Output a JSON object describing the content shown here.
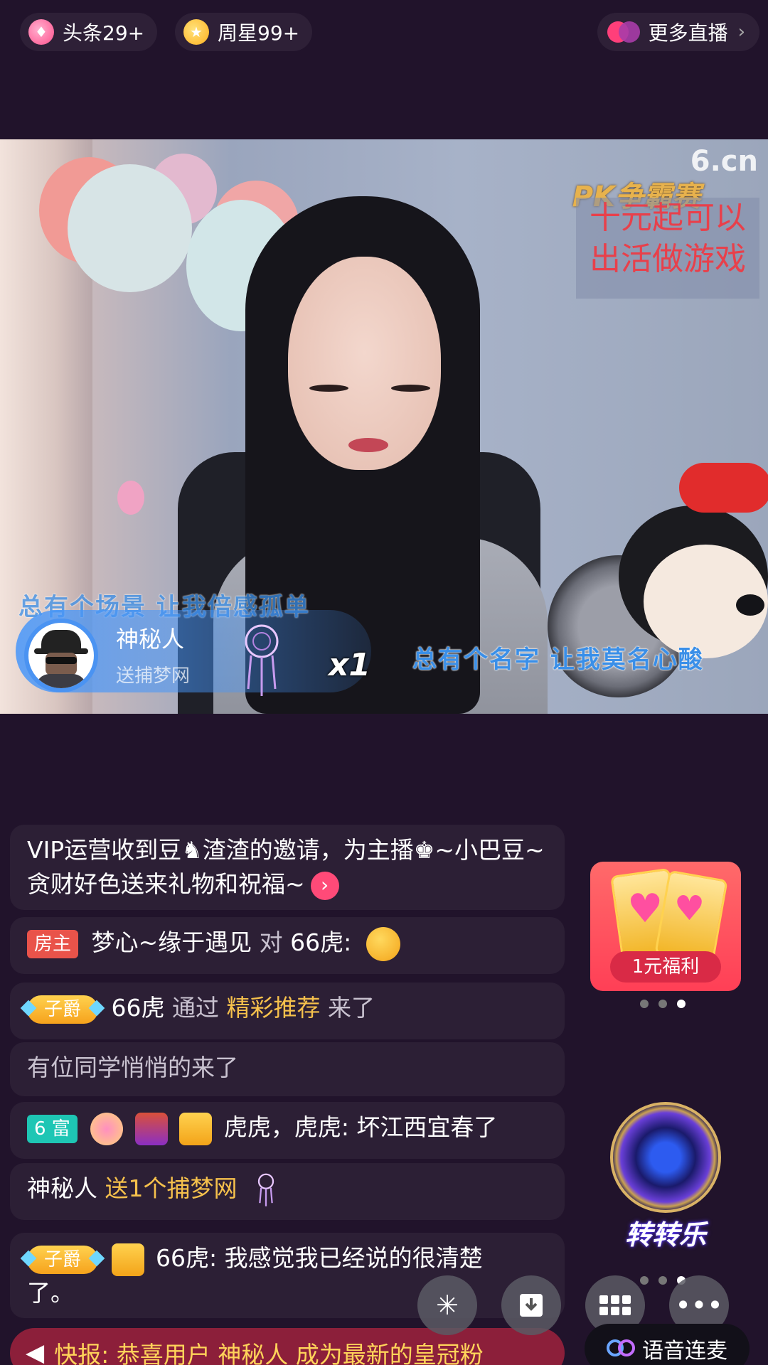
{
  "topbar": {
    "headline": "头条29+",
    "weekstar": "周星99+",
    "more_live": "更多直播"
  },
  "video": {
    "watermark": "6.cn",
    "pk_title": "PK争霸赛",
    "promo_line1": "十元起可以",
    "promo_line2": "出活做游戏",
    "lyric_1": "总有个场景 让我倍感孤单",
    "lyric_2": "总有个名字 让我莫名心酸",
    "gift_toast": {
      "name": "神秘人",
      "action": "送捕梦网",
      "count": "x1"
    }
  },
  "chat": {
    "messages": [
      {
        "text": "VIP运营收到豆♞渣渣的邀请，为主播♚~小巴豆~贪财好色送来礼物和祝福~"
      },
      {
        "badge": "房主",
        "user": "梦心~缘于遇见",
        "to": "对",
        "target": "66虎:"
      },
      {
        "badge": "子爵",
        "user": "66虎",
        "via": "通过",
        "source": "精彩推荐",
        "action": "来了"
      },
      {
        "text": "有位同学悄悄的来了"
      },
      {
        "badge": "6 富",
        "user": "虎虎，",
        "content": "虎虎: 坏江西宜春了"
      },
      {
        "user": "神秘人",
        "gift": "送1个捕梦网"
      },
      {
        "badge": "子爵",
        "content_line1": "66虎: 我感觉我已经说的很清楚",
        "content_line2": "了。"
      }
    ],
    "news": "快报: 恭喜用户 神秘人 成为最新的皇冠粉"
  },
  "side": {
    "promo_label": "1元福利",
    "spin_label": "转转乐",
    "voice_label": "语音连麦"
  },
  "colors": {
    "background": "#21132b",
    "gold": "#f6c14c",
    "host_badge": "#e9534a",
    "rich_badge": "#1ec6b4",
    "news_bar": "#8c1f3a"
  },
  "icons": [
    "flame-icon",
    "star-icon",
    "live-logo-icon",
    "chevron-right-icon",
    "sparkle-icon",
    "save-download-icon",
    "grid-icon",
    "more-icon",
    "speaker-icon",
    "link-icon"
  ]
}
